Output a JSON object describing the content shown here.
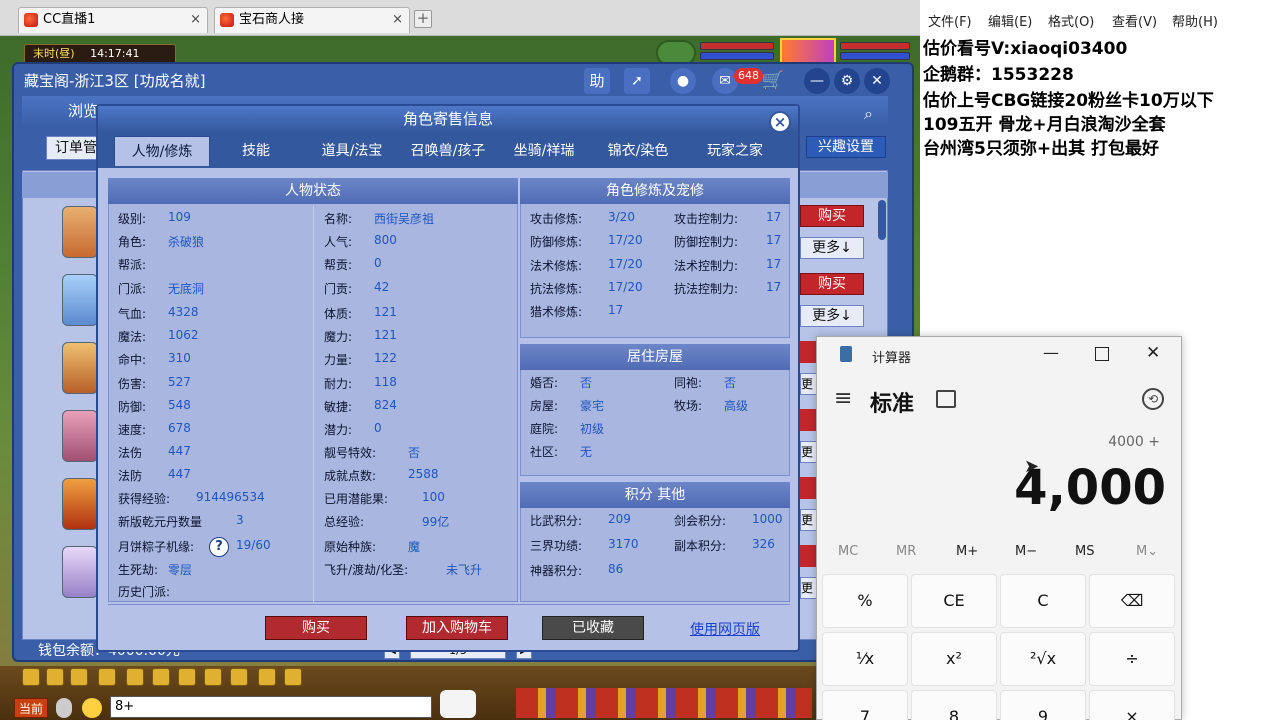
{
  "browser": {
    "tabs": [
      {
        "label": "CC直播1"
      },
      {
        "label": "宝石商人接"
      }
    ],
    "newtab": "+",
    "close": "×"
  },
  "game": {
    "time_label": "末时(昼)",
    "time_value": "14:17:41",
    "chat_button": "当前",
    "chat_input": "8+",
    "wallet_label": "钱包余额：",
    "wallet_value": "4000.00元",
    "pager": "1/5"
  },
  "cbg": {
    "title": "藏宝阁-浙江3区 [功成名就]",
    "help": "助",
    "msg_count": "648",
    "browse": "浏览",
    "order_label": "订单管",
    "interest_button": "兴趣设置",
    "buy_label": "购买",
    "more_label": "更多↓",
    "more_short": "更"
  },
  "dialog": {
    "title": "角色寄售信息",
    "close": "×",
    "tabs": [
      "人物/修炼",
      "技能",
      "道具/法宝",
      "召唤兽/孩子",
      "坐骑/祥瑞",
      "锦衣/染色",
      "玩家之家"
    ],
    "status": {
      "header": "人物状态",
      "left": [
        [
          "级别:",
          "109"
        ],
        [
          "角色:",
          "杀破狼"
        ],
        [
          "帮派:",
          ""
        ],
        [
          "门派:",
          "无底洞"
        ],
        [
          "气血:",
          "4328"
        ],
        [
          "魔法:",
          "1062"
        ],
        [
          "命中:",
          "310"
        ],
        [
          "伤害:",
          "527"
        ],
        [
          "防御:",
          "548"
        ],
        [
          "速度:",
          "678"
        ],
        [
          "法伤",
          "447"
        ],
        [
          "法防",
          "447"
        ],
        [
          "获得经验:",
          "914496534"
        ],
        [
          "新版乾元丹数量",
          "3"
        ],
        [
          "月饼粽子机缘:",
          "19/60"
        ],
        [
          "生死劫:",
          "零层"
        ],
        [
          "历史门派:",
          ""
        ]
      ],
      "right": [
        [
          "名称:",
          "西街吴彦祖"
        ],
        [
          "人气:",
          "800"
        ],
        [
          "帮贡:",
          "0"
        ],
        [
          "门贡:",
          "42"
        ],
        [
          "体质:",
          "121"
        ],
        [
          "魔力:",
          "121"
        ],
        [
          "力量:",
          "122"
        ],
        [
          "耐力:",
          "118"
        ],
        [
          "敏捷:",
          "824"
        ],
        [
          "潜力:",
          "0"
        ],
        [
          "靓号特效:",
          "否"
        ],
        [
          "成就点数:",
          "2588"
        ],
        [
          "已用潜能果:",
          "100"
        ],
        [
          "总经验:",
          "99亿"
        ],
        [
          "原始种族:",
          "魔"
        ],
        [
          "飞升/渡劫/化圣:",
          "未飞升"
        ]
      ]
    },
    "cultivate": {
      "header": "角色修炼及宠修",
      "rows": [
        [
          "攻击修炼:",
          "3/20",
          "攻击控制力:",
          "17"
        ],
        [
          "防御修炼:",
          "17/20",
          "防御控制力:",
          "17"
        ],
        [
          "法术修炼:",
          "17/20",
          "法术控制力:",
          "17"
        ],
        [
          "抗法修炼:",
          "17/20",
          "抗法控制力:",
          "17"
        ],
        [
          "猎术修炼:",
          "17",
          "",
          ""
        ]
      ]
    },
    "house": {
      "header": "居住房屋",
      "rows": [
        [
          "婚否:",
          "否",
          "同袍:",
          "否"
        ],
        [
          "房屋:",
          "豪宅",
          "牧场:",
          "高级"
        ],
        [
          "庭院:",
          "初级",
          "",
          ""
        ],
        [
          "社区:",
          "无",
          "",
          ""
        ]
      ]
    },
    "points": {
      "header": "积分 其他",
      "rows": [
        [
          "比武积分:",
          "209",
          "剑会积分:",
          "1000"
        ],
        [
          "三界功绩:",
          "3170",
          "副本积分:",
          "326"
        ],
        [
          "神器积分:",
          "86",
          "",
          ""
        ]
      ]
    },
    "buttons": {
      "buy": "购买",
      "cart": "加入购物车",
      "saved": "已收藏",
      "web": "使用网页版"
    },
    "help_icon": "?"
  },
  "notepad": {
    "menu": [
      "文件(F)",
      "编辑(E)",
      "格式(O)",
      "查看(V)",
      "帮助(H)"
    ],
    "lines": [
      "估价看号V:xiaoqi03400",
      "企鹅群：1553228",
      "估价上号CBG链接20粉丝卡10万以下",
      "109五开 骨龙+月白浪淘沙全套",
      "台州湾5只须弥+出其 打包最好"
    ]
  },
  "calculator": {
    "app_title": "计算器",
    "mode": "标准",
    "expression": "4000 +",
    "display": "4,000",
    "memory": [
      "MC",
      "MR",
      "M+",
      "M−",
      "MS",
      "M⌄"
    ],
    "rows": [
      [
        "%",
        "CE",
        "C",
        "⌫"
      ],
      [
        "¹⁄x",
        "x²",
        "²√x",
        "÷"
      ],
      [
        "7",
        "8",
        "9",
        "×"
      ]
    ]
  },
  "colors": {
    "accent": "#34589e",
    "buy": "#c2262b",
    "calc_bg": "#f3f3f3"
  }
}
